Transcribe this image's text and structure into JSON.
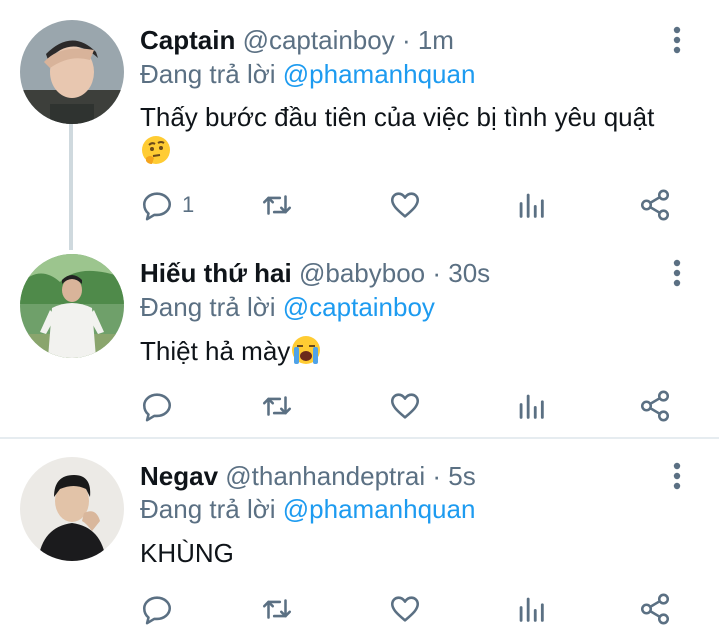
{
  "tweets": [
    {
      "name": "Captain",
      "handle": "@captainboy",
      "dot": " · ",
      "time": "1m",
      "replying_prefix": "Đang trả lời ",
      "replying_to": "@phamanhquan",
      "text_line1": "Thấy bước đầu tiên của việc bị tình yêu quật",
      "emoji_icon": "thinking-face",
      "reply_count": "1"
    },
    {
      "name": "Hiếu thứ hai",
      "handle": "@babyboo",
      "dot": " · ",
      "time": "30s",
      "replying_prefix": "Đang trả lời ",
      "replying_to": "@captainboy",
      "text_line1": "Thiệt hả mày",
      "emoji_icon": "loudly-crying-face",
      "reply_count": ""
    },
    {
      "name": "Negav",
      "handle": "@thanhandeptrai",
      "dot": " · ",
      "time": "5s",
      "replying_prefix": "Đang trả lời ",
      "replying_to": "@phamanhquan",
      "text_line1": "KHÙNG",
      "reply_count": ""
    }
  ],
  "icons": {
    "reply": "reply-icon",
    "retweet": "retweet-icon",
    "like": "heart-icon",
    "analytics": "analytics-icon",
    "share": "share-icon",
    "more": "more-vertical-icon"
  },
  "colors": {
    "name": "#0f1419",
    "meta": "#5b7083",
    "mention": "#1d9bf0",
    "thread_line": "#cfd9de"
  }
}
